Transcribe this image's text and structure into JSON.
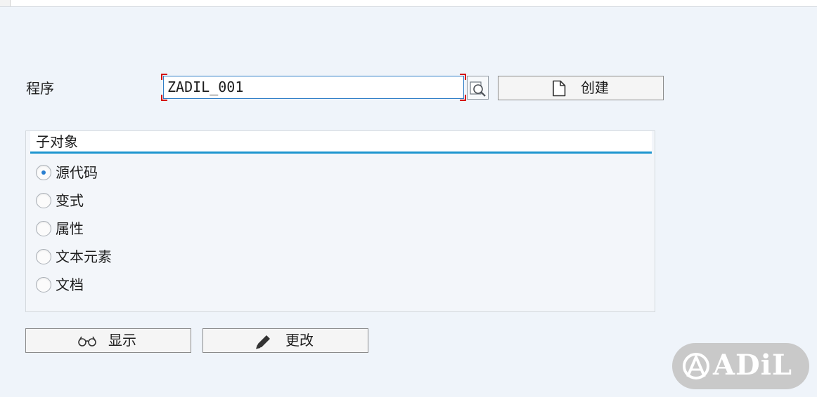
{
  "program": {
    "label": "程序",
    "value": "ZADIL_001",
    "create_label": "创建"
  },
  "subobjects": {
    "title": "子对象",
    "options": [
      {
        "label": "源代码",
        "selected": true
      },
      {
        "label": "变式",
        "selected": false
      },
      {
        "label": "属性",
        "selected": false
      },
      {
        "label": "文本元素",
        "selected": false
      },
      {
        "label": "文档",
        "selected": false
      }
    ]
  },
  "actions": {
    "display_label": "显示",
    "change_label": "更改"
  },
  "watermark": {
    "text": "ADiL"
  },
  "colors": {
    "accent": "#1d95cf",
    "focus": "#d40000",
    "background": "#eff4fa"
  }
}
